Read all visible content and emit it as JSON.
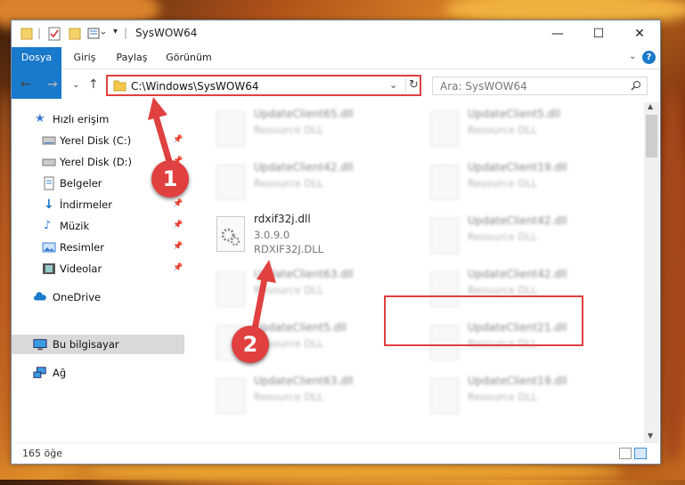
{
  "window": {
    "title": "SysWOW64",
    "controls": {
      "minimize": "—",
      "maximize": "☐",
      "close": "✕"
    }
  },
  "ribbon": {
    "tabs": [
      "Dosya",
      "Giriş",
      "Paylaş",
      "Görünüm"
    ],
    "help": "?"
  },
  "address": {
    "path": "C:\\Windows\\SysWOW64",
    "search_placeholder": "Ara: SysWOW64"
  },
  "sidebar": {
    "items": [
      {
        "label": "Hızlı erişim",
        "icon": "star-icon",
        "pinned": false
      },
      {
        "label": "Yerel Disk (C:)",
        "icon": "drive-icon",
        "pinned": true
      },
      {
        "label": "Yerel Disk (D:)",
        "icon": "drive-icon",
        "pinned": true
      },
      {
        "label": "Belgeler",
        "icon": "documents-icon",
        "pinned": true
      },
      {
        "label": "İndirmeler",
        "icon": "download-icon",
        "pinned": true
      },
      {
        "label": "Müzik",
        "icon": "music-icon",
        "pinned": true
      },
      {
        "label": "Resimler",
        "icon": "pictures-icon",
        "pinned": true
      },
      {
        "label": "Videolar",
        "icon": "videos-icon",
        "pinned": true
      },
      {
        "label": "OneDrive",
        "icon": "cloud-icon",
        "pinned": false
      },
      {
        "label": "Bu bilgisayar",
        "icon": "computer-icon",
        "pinned": false,
        "selected": true
      },
      {
        "label": "Ağ",
        "icon": "network-icon",
        "pinned": false
      }
    ]
  },
  "files": {
    "left": [
      {
        "name": "UpdateClient65.dll",
        "sub": "Resource DLL"
      },
      {
        "name": "UpdateClient42.dll",
        "sub": "Resource DLL"
      },
      {
        "name": "UpdateClient63.dll",
        "sub": "Resource DLL"
      },
      {
        "name": "UpdateClient5.dll",
        "sub": "Resource DLL"
      },
      {
        "name": "UpdateClient63.dll",
        "sub": "Resource DLL"
      }
    ],
    "right": [
      {
        "name": "UpdateClient5.dll",
        "sub": "Resource DLL"
      },
      {
        "name": "UpdateClient19.dll",
        "sub": "Resource DLL"
      },
      {
        "name": "UpdateClient42.dll",
        "sub": "Resource DLL"
      },
      {
        "name": "UpdateClient42.dll",
        "sub": "Resource DLL"
      },
      {
        "name": "UpdateClient21.dll",
        "sub": "Resource DLL"
      },
      {
        "name": "UpdateClient19.dll",
        "sub": "Resource DLL"
      }
    ],
    "target": {
      "name": "rdxif32j.dll",
      "version": "3.0.9.0",
      "description": "RDXIF32J.DLL"
    }
  },
  "status": {
    "count": "165 öğe"
  },
  "annotations": {
    "step1": "1",
    "step2": "2"
  },
  "colors": {
    "accent": "#1979ca",
    "highlight": "#e04040"
  }
}
